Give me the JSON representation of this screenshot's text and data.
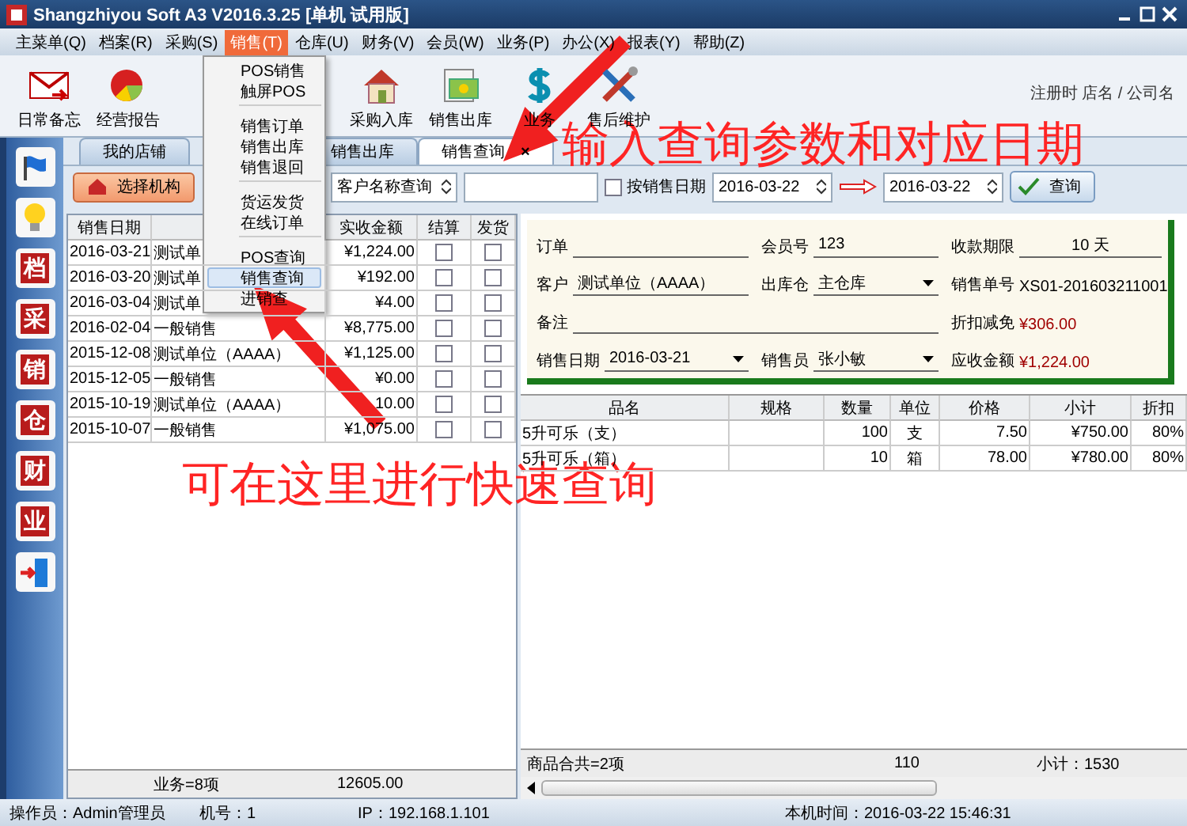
{
  "window": {
    "title": "Shangzhiyou Soft A3 V2016.3.25 [单机 试用版]"
  },
  "menu_bar": [
    {
      "label": "主菜单(Q)",
      "selected": false
    },
    {
      "label": "档案(R)",
      "selected": false
    },
    {
      "label": "采购(S)",
      "selected": false
    },
    {
      "label": "销售(T)",
      "selected": true
    },
    {
      "label": "仓库(U)",
      "selected": false
    },
    {
      "label": "财务(V)",
      "selected": false
    },
    {
      "label": "会员(W)",
      "selected": false
    },
    {
      "label": "业务(P)",
      "selected": false
    },
    {
      "label": "办公(X)",
      "selected": false
    },
    {
      "label": "报表(Y)",
      "selected": false
    },
    {
      "label": "帮助(Z)",
      "selected": false
    }
  ],
  "toolbar": [
    {
      "kind": "mail",
      "label": "日常备忘"
    },
    {
      "kind": "chart",
      "label": "经营报告"
    },
    {
      "kind": "house",
      "label": "采购入库"
    },
    {
      "kind": "cash",
      "label": "销售出库"
    },
    {
      "kind": "dollar",
      "label": "业务"
    },
    {
      "kind": "tools",
      "label": "售后维护"
    }
  ],
  "registration_note": "注册时 店名 / 公司名",
  "tabs": [
    {
      "label": "我的店铺",
      "selected": false
    },
    {
      "label": "销售出库",
      "selected": false
    },
    {
      "label": "销售查询",
      "selected": true,
      "close": "×"
    }
  ],
  "query_bar": {
    "org_button": "选择机构",
    "search_mode": "客户名称查询",
    "by_date_checkbox": {
      "label": "按销售日期",
      "checked": false
    },
    "date_from": "2016-03-22",
    "date_to": "2016-03-22",
    "query_button": "查询"
  },
  "sidebar": [
    {
      "kind": "flag"
    },
    {
      "kind": "bulb"
    },
    {
      "kind": "seal",
      "label": "档"
    },
    {
      "kind": "seal",
      "label": "采"
    },
    {
      "kind": "seal",
      "label": "销"
    },
    {
      "kind": "seal",
      "label": "仓"
    },
    {
      "kind": "seal",
      "label": "财"
    },
    {
      "kind": "seal",
      "label": "业"
    },
    {
      "kind": "exit"
    }
  ],
  "sales_table": {
    "columns": [
      "销售日期",
      "",
      "实收金额",
      "结算",
      "发货"
    ],
    "rows": [
      {
        "date": "2016-03-21",
        "customer": "测试单",
        "amount": "¥1,224.00",
        "settled": false,
        "shipped": false
      },
      {
        "date": "2016-03-20",
        "customer": "测试单",
        "amount": "¥192.00",
        "settled": false,
        "shipped": false
      },
      {
        "date": "2016-03-04",
        "customer": "测试单",
        "amount": "¥4.00",
        "settled": false,
        "shipped": false
      },
      {
        "date": "2016-02-04",
        "customer": "一般销售",
        "amount": "¥8,775.00",
        "settled": false,
        "shipped": false
      },
      {
        "date": "2015-12-08",
        "customer": "测试单位（AAAA）",
        "amount": "¥1,125.00",
        "settled": false,
        "shipped": false
      },
      {
        "date": "2015-12-05",
        "customer": "一般销售",
        "amount": "¥0.00",
        "settled": false,
        "shipped": false
      },
      {
        "date": "2015-10-19",
        "customer": "测试单位（AAAA）",
        "amount": "10.00",
        "settled": false,
        "shipped": false
      },
      {
        "date": "2015-10-07",
        "customer": "一般销售",
        "amount": "¥1,075.00",
        "settled": false,
        "shipped": false
      }
    ],
    "footer": {
      "count": "业务=8项",
      "total": "12605.00"
    }
  },
  "order_form": {
    "order_label": "订单",
    "member_label": "会员号",
    "member": "123",
    "term_label": "收款期限",
    "term": "10",
    "term_unit": "天",
    "customer_label": "客户",
    "customer": "测试单位（AAAA）",
    "warehouse_label": "出库仓",
    "warehouse": "主仓库",
    "order_no_label": "销售单号",
    "order_no": "XS01-201603211001",
    "note_label": "备注",
    "discount_label": "折扣减免",
    "discount": "¥306.00",
    "date_label": "销售日期",
    "date": "2016-03-21",
    "seller_label": "销售员",
    "seller": "张小敏",
    "due_label": "应收金额",
    "due": "¥1,224.00"
  },
  "items_table": {
    "columns": [
      "品名",
      "规格",
      "数量",
      "单位",
      "价格",
      "小计",
      "折扣"
    ],
    "rows": [
      [
        "5升可乐（支）",
        "",
        "100",
        "支",
        "7.50",
        "¥750.00",
        "80%"
      ],
      [
        "5升可乐（箱）",
        "",
        "10",
        "箱",
        "78.00",
        "¥780.00",
        "80%"
      ]
    ],
    "footer": {
      "count": "商品合共=2项",
      "quantity": "110",
      "subtotal": "小计：1530"
    }
  },
  "open_menu": {
    "items": [
      {
        "label": "POS销售",
        "selected": false
      },
      {
        "label": "触屏POS",
        "selected": false
      },
      {
        "kind": "separator"
      },
      {
        "label": "销售订单",
        "selected": false
      },
      {
        "label": "销售出库",
        "selected": false
      },
      {
        "label": "销售退回",
        "selected": false
      },
      {
        "kind": "separator"
      },
      {
        "label": "货运发货",
        "selected": false
      },
      {
        "label": "在线订单",
        "selected": false
      },
      {
        "kind": "separator"
      },
      {
        "label": "POS查询",
        "selected": false
      },
      {
        "label": "销售查询",
        "selected": true
      },
      {
        "label": "进销查",
        "selected": false
      }
    ]
  },
  "status_bar": [
    "操作员：Admin管理员",
    "机号：1",
    "IP：192.168.1.101",
    "本机时间：2016-03-22 15:46:31"
  ],
  "annotations": [
    "输入查询参数和对应日期",
    "可在这里进行快速查询"
  ]
}
